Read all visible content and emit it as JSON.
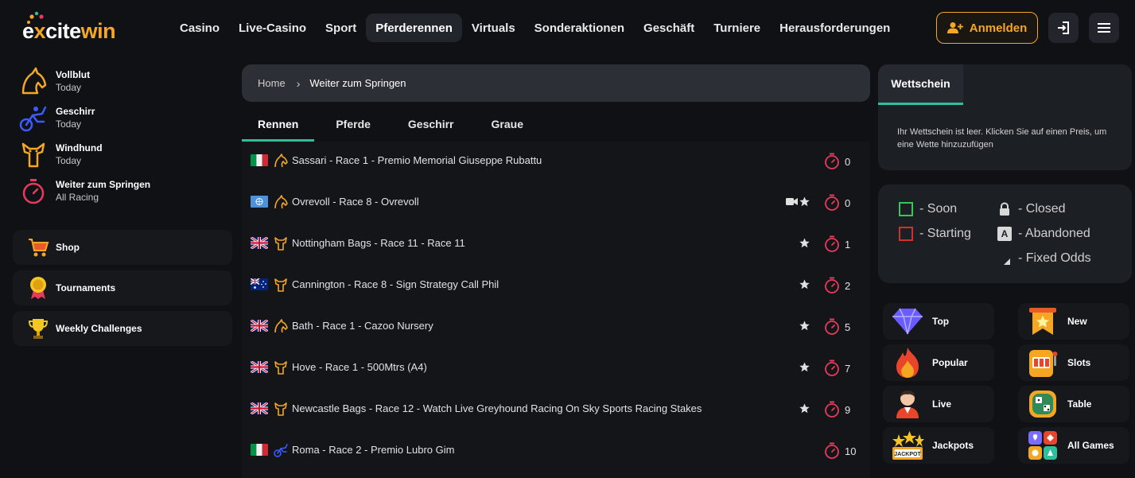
{
  "header": {
    "logo": {
      "part1": "e",
      "part2": "x",
      "part3": "cite",
      "part4": "win"
    },
    "nav": [
      "Casino",
      "Live-Casino",
      "Sport",
      "Pferderennen",
      "Virtuals",
      "Sonderaktionen",
      "Geschäft",
      "Turniere",
      "Herausforderungen"
    ],
    "active_nav": "Pferderennen",
    "login_label": "Anmelden"
  },
  "sidebar": {
    "categories": [
      {
        "title": "Vollblut",
        "sub": "Today",
        "icon": "horse-head-icon"
      },
      {
        "title": "Geschirr",
        "sub": "Today",
        "icon": "harness-cart-icon"
      },
      {
        "title": "Windhund",
        "sub": "Today",
        "icon": "greyhound-icon"
      },
      {
        "title": "Weiter zum Springen",
        "sub": "All Racing",
        "icon": "stopwatch-icon"
      }
    ],
    "links": [
      {
        "label": "Shop",
        "icon": "shopping-cart-icon"
      },
      {
        "label": "Tournaments",
        "icon": "medal-icon"
      },
      {
        "label": "Weekly Challenges",
        "icon": "trophy-icon"
      }
    ]
  },
  "breadcrumb": {
    "home": "Home",
    "current": "Weiter zum Springen"
  },
  "tabs": [
    "Rennen",
    "Pferde",
    "Geschirr",
    "Graue"
  ],
  "races": [
    {
      "flag": "it",
      "type": "horse",
      "name": "Sassari - Race 1 - Premio Memorial Giuseppe Rubattu",
      "camera": false,
      "star": false,
      "count": "0"
    },
    {
      "flag": "un",
      "type": "horse",
      "name": "Ovrevoll - Race 8 - Ovrevoll",
      "camera": true,
      "star": true,
      "count": "0"
    },
    {
      "flag": "gb",
      "type": "greyhound",
      "name": "Nottingham Bags - Race 11 - Race 11",
      "camera": false,
      "star": true,
      "count": "1"
    },
    {
      "flag": "au",
      "type": "greyhound",
      "name": "Cannington - Race 8 - Sign Strategy Call Phil",
      "camera": false,
      "star": true,
      "count": "2"
    },
    {
      "flag": "gb",
      "type": "horse",
      "name": "Bath - Race 1 - Cazoo Nursery",
      "camera": false,
      "star": true,
      "count": "5"
    },
    {
      "flag": "gb",
      "type": "greyhound",
      "name": "Hove - Race 1 - 500Mtrs (A4)",
      "camera": false,
      "star": true,
      "count": "7"
    },
    {
      "flag": "gb",
      "type": "greyhound",
      "name": "Newcastle Bags - Race 12 - Watch Live Greyhound Racing On Sky Sports Racing Stakes",
      "camera": false,
      "star": true,
      "count": "9"
    },
    {
      "flag": "it",
      "type": "harness",
      "name": "Roma - Race 2 - Premio Lubro Gim",
      "camera": false,
      "star": false,
      "count": "10"
    }
  ],
  "betslip": {
    "tab": "Wettschein",
    "empty": "Ihr Wettschein ist leer. Klicken Sie auf einen Preis, um eine Wette hinzuzufügen"
  },
  "legend": {
    "soon": "- Soon",
    "starting": "- Starting",
    "closed": "- Closed",
    "abandoned": "- Abandoned",
    "fixed_odds": "- Fixed Odds",
    "abandoned_letter": "A"
  },
  "quick_links": [
    "Top",
    "New",
    "Popular",
    "Slots",
    "Live",
    "Table",
    "Jackpots",
    "All Games"
  ],
  "colors": {
    "accent": "#2fbf9a",
    "brand_orange": "#f5a623",
    "timer_red": "#e83a5c",
    "soon_green": "#35c759",
    "starting_red": "#d0312d"
  }
}
